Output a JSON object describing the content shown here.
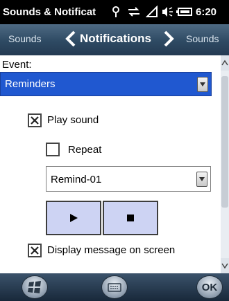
{
  "titlebar": {
    "title": "Sounds & Notificat",
    "time": "6:20"
  },
  "navbar": {
    "left": "Sounds",
    "center": "Notifications",
    "right": "Sounds"
  },
  "event": {
    "label": "Event:",
    "value": "Reminders"
  },
  "play_sound": {
    "label": "Play sound",
    "checked": true
  },
  "repeat": {
    "label": "Repeat",
    "checked": false
  },
  "sound_select": {
    "value": "Remind-01"
  },
  "display_message": {
    "label": "Display message on screen",
    "checked": true
  },
  "bottombar": {
    "ok_label": "OK"
  },
  "icons": [
    "antenna-icon",
    "sync-icon",
    "signal-icon",
    "volume-icon",
    "battery-icon",
    "windows-icon",
    "keyboard-icon",
    "play-icon",
    "stop-icon"
  ]
}
